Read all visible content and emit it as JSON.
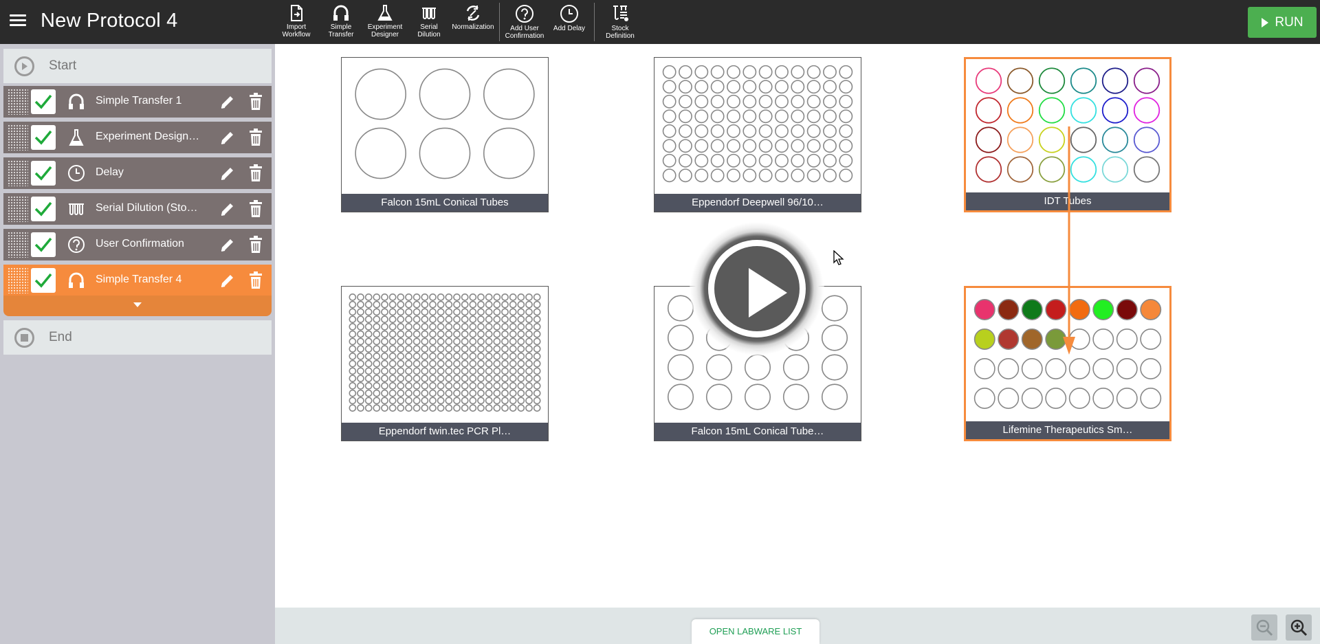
{
  "app": {
    "title": "New Protocol 4"
  },
  "toolbar": {
    "tools": [
      {
        "label_line1": "Import",
        "label_line2": "Workflow",
        "icon": "import-icon"
      },
      {
        "label_line1": "Simple",
        "label_line2": "Transfer",
        "icon": "transfer-icon"
      },
      {
        "label_line1": "Experiment",
        "label_line2": "Designer",
        "icon": "flask-icon"
      },
      {
        "label_line1": "Serial",
        "label_line2": "Dilution",
        "icon": "serial-dilution-icon"
      },
      {
        "label_line1": "Normalization",
        "label_line2": "",
        "icon": "normalization-icon"
      },
      {
        "label_line1": "Add User",
        "label_line2": "Confirmation",
        "icon": "question-icon"
      },
      {
        "label_line1": "Add Delay",
        "label_line2": "",
        "icon": "clock-icon"
      },
      {
        "label_line1": "Stock",
        "label_line2": "Definition",
        "icon": "tubes-icon"
      }
    ],
    "run_label": "RUN"
  },
  "sidebar": {
    "start_label": "Start",
    "end_label": "End",
    "steps": [
      {
        "label": "Simple Transfer 1",
        "icon": "transfer-icon",
        "checked": true,
        "active": false
      },
      {
        "label": "Experiment Design…",
        "icon": "flask-icon",
        "checked": true,
        "active": false
      },
      {
        "label": "Delay",
        "icon": "clock-icon",
        "checked": true,
        "active": false
      },
      {
        "label": "Serial Dilution (Sto…",
        "icon": "serial-dilution-icon",
        "checked": true,
        "active": false
      },
      {
        "label": "User Confirmation",
        "icon": "question-icon",
        "checked": true,
        "active": false
      },
      {
        "label": "Simple Transfer 4",
        "icon": "transfer-icon",
        "checked": true,
        "active": true
      }
    ]
  },
  "labware": [
    {
      "name": "Falcon 15mL Conical Tubes",
      "rows": 2,
      "cols": 3,
      "selected": false
    },
    {
      "name": "Eppendorf Deepwell 96/10…",
      "rows": 8,
      "cols": 12,
      "selected": false
    },
    {
      "name": "IDT Tubes",
      "rows": 4,
      "cols": 6,
      "selected": true,
      "well_outline_colors": [
        "#e83a7a",
        "#8b5a2b",
        "#1e8a3c",
        "#1b8a8a",
        "#1e1e8a",
        "#8a1e8a",
        "#c0262d",
        "#f07a1a",
        "#22dd44",
        "#33e0e0",
        "#1e1ecc",
        "#e022e0",
        "#8b1a1a",
        "#f5a05a",
        "#c8d21e",
        "#666666",
        "#2a8a9a",
        "#5a5ad2",
        "#b03030",
        "#a0653a",
        "#8aa040",
        "#33e0e0",
        "#7ad8d8",
        "#777777"
      ]
    },
    {
      "name": "Eppendorf twin.tec PCR Pl…",
      "rows": 16,
      "cols": 24,
      "selected": false
    },
    {
      "name": "Falcon 15mL Conical Tube…",
      "rows": 4,
      "cols": 5,
      "selected": false
    },
    {
      "name": "Lifemine Therapeutics Sm…",
      "rows": 4,
      "cols": 8,
      "selected": true,
      "well_fill_colors": [
        "#e8336d",
        "#8b2a12",
        "#0f7a1a",
        "#c41d1d",
        "#f26b10",
        "#22ee22",
        "#7a0a0a",
        "#f5883a",
        "#b8d01e",
        "#b03830",
        "#a0662a",
        "#7a9a3a"
      ]
    }
  ],
  "footer": {
    "open_labware_label": "OPEN LABWARE LIST",
    "zoom_out_icon": "zoom-out-icon",
    "zoom_in_icon": "zoom-in-icon"
  },
  "colors": {
    "accent": "#f68b3d",
    "run": "#4caf50",
    "check": "#1faa3a",
    "header": "#2b2b2b"
  }
}
